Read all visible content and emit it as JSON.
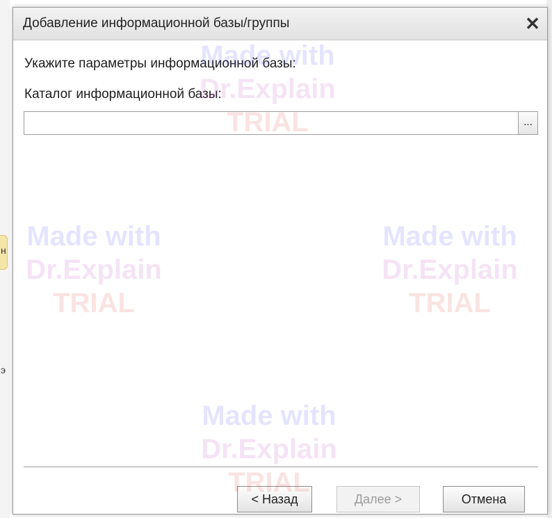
{
  "dialog": {
    "title": "Добавление информационной базы/группы",
    "close_icon": "close-icon",
    "close_glyph": "✕",
    "heading": "Укажите параметры информационной базы:",
    "catalog_label": "Каталог информационной базы:",
    "catalog_value": "",
    "browse_label": "...",
    "buttons": {
      "back": "< Назад",
      "next": "Далее >",
      "cancel": "Отмена"
    }
  },
  "background": {
    "left_glyph_1": "н",
    "left_glyph_2": "э"
  },
  "watermark": {
    "line1": "Made with",
    "line2": "Dr.Explain",
    "line3": "TRIAL"
  },
  "colors": {
    "watermark_blue": "#4a4aff",
    "watermark_purple": "#c040c0",
    "watermark_red": "#e04040",
    "disabled_text": "#9b9b9b"
  }
}
